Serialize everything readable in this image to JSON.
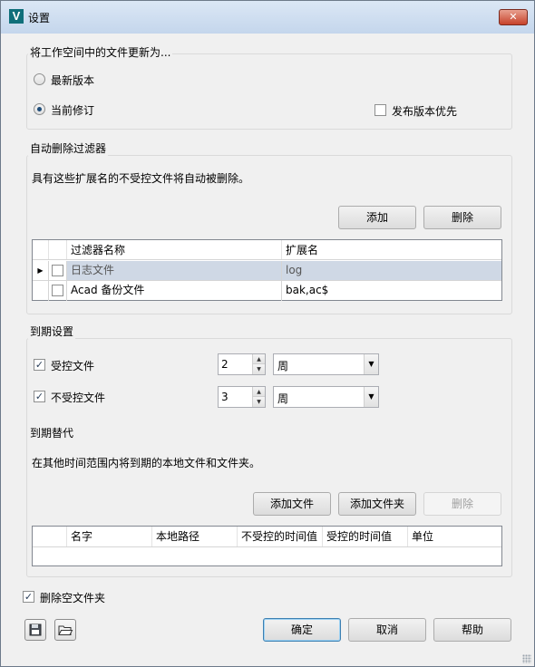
{
  "window": {
    "title": "设置",
    "app_icon_letter": "V",
    "close_label": "✕"
  },
  "update_group": {
    "title": "将工作空间中的文件更新为...",
    "option_latest": "最新版本",
    "option_current": "当前修订",
    "selected": "当前修订",
    "release_priority_label": "发布版本优先",
    "release_priority_checked": false
  },
  "filter_group": {
    "title": "自动删除过滤器",
    "description": "具有这些扩展名的不受控文件将自动被删除。",
    "add_label": "添加",
    "delete_label": "删除",
    "columns": [
      "过滤器名称",
      "扩展名"
    ],
    "rows": [
      {
        "name": "日志文件",
        "ext": "log",
        "checked": false,
        "selected": true
      },
      {
        "name": "Acad 备份文件",
        "ext": "bak,ac$",
        "checked": false,
        "selected": false
      }
    ]
  },
  "expire_group": {
    "title": "到期设置",
    "controlled_label": "受控文件",
    "controlled_checked": true,
    "controlled_value": "2",
    "controlled_unit": "周",
    "uncontrolled_label": "不受控文件",
    "uncontrolled_checked": true,
    "uncontrolled_value": "3",
    "uncontrolled_unit": "周"
  },
  "override_group": {
    "title": "到期替代",
    "description": "在其他时间范围内将到期的本地文件和文件夹。",
    "add_file_label": "添加文件",
    "add_folder_label": "添加文件夹",
    "delete_label": "删除",
    "columns": [
      "名字",
      "本地路径",
      "不受控的时间值",
      "受控的时间值",
      "单位"
    ]
  },
  "delete_empty_folders_label": "删除空文件夹",
  "delete_empty_folders_checked": true,
  "footer": {
    "ok_label": "确定",
    "cancel_label": "取消",
    "help_label": "帮助"
  }
}
